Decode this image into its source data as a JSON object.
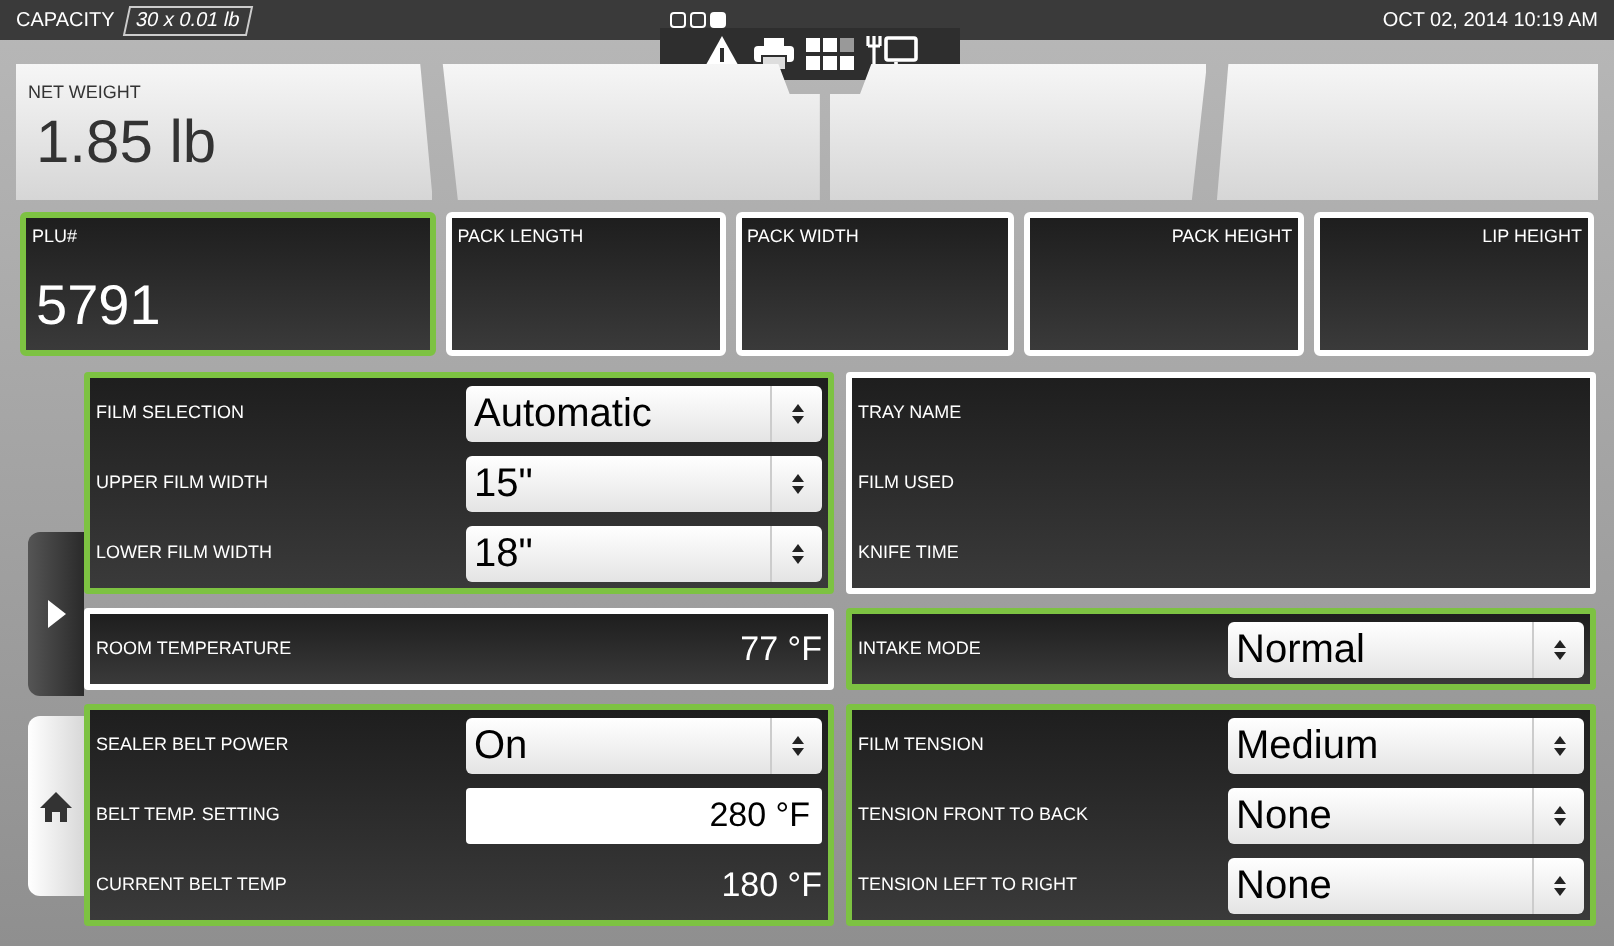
{
  "top_bar": {
    "capacity_label": "CAPACITY",
    "capacity_value": "30 x 0.01 lb",
    "pages": [
      {
        "selected": false
      },
      {
        "selected": false
      },
      {
        "selected": true
      }
    ],
    "datetime": "OCT 02, 2014 10:19 AM"
  },
  "header_cards": [
    {
      "label": "NET WEIGHT",
      "value": "1.85 lb"
    }
  ],
  "tiles": [
    {
      "label": "PLU#",
      "value": "5791",
      "highlighted": true,
      "label_right": false
    },
    {
      "label": "PACK LENGTH",
      "highlighted": false,
      "label_right": false
    },
    {
      "label": "PACK WIDTH",
      "highlighted": false,
      "label_right": false
    },
    {
      "label": "PACK HEIGHT",
      "highlighted": false,
      "label_right": true
    },
    {
      "label": "LIP HEIGHT",
      "highlighted": false,
      "label_right": true
    }
  ],
  "panels": [
    {
      "highlighted": true,
      "rows": [
        {
          "kind": "select",
          "label": "FILM SELECTION",
          "value": "Automatic"
        },
        {
          "kind": "select",
          "label": "UPPER FILM WIDTH",
          "value": "15\""
        },
        {
          "kind": "select",
          "label": "LOWER FILM WIDTH",
          "value": "18\""
        }
      ]
    },
    {
      "highlighted": false,
      "rows": [
        {
          "kind": "reading",
          "label": "TRAY NAME"
        },
        {
          "kind": "reading",
          "label": "FILM USED"
        },
        {
          "kind": "reading",
          "label": "KNIFE TIME"
        }
      ]
    },
    {
      "highlighted": false,
      "rows": [
        {
          "kind": "reading",
          "label": "ROOM TEMPERATURE",
          "value": "77 °F"
        }
      ]
    },
    {
      "highlighted": true,
      "rows": [
        {
          "kind": "select",
          "label": "INTAKE MODE",
          "value": "Normal"
        }
      ]
    },
    {
      "highlighted": true,
      "rows": [
        {
          "kind": "select",
          "label": "SEALER BELT POWER",
          "value": "On"
        },
        {
          "kind": "input",
          "label": "BELT TEMP. SETTING",
          "value": "280 °F"
        },
        {
          "kind": "reading",
          "label": "CURRENT BELT TEMP",
          "value": "180 °F"
        }
      ]
    },
    {
      "highlighted": true,
      "rows": [
        {
          "kind": "select",
          "label": "FILM TENSION",
          "value": "Medium"
        },
        {
          "kind": "select",
          "label": "TENSION FRONT TO BACK",
          "value": "None"
        },
        {
          "kind": "select",
          "label": "TENSION LEFT TO RIGHT",
          "value": "None"
        }
      ]
    }
  ]
}
